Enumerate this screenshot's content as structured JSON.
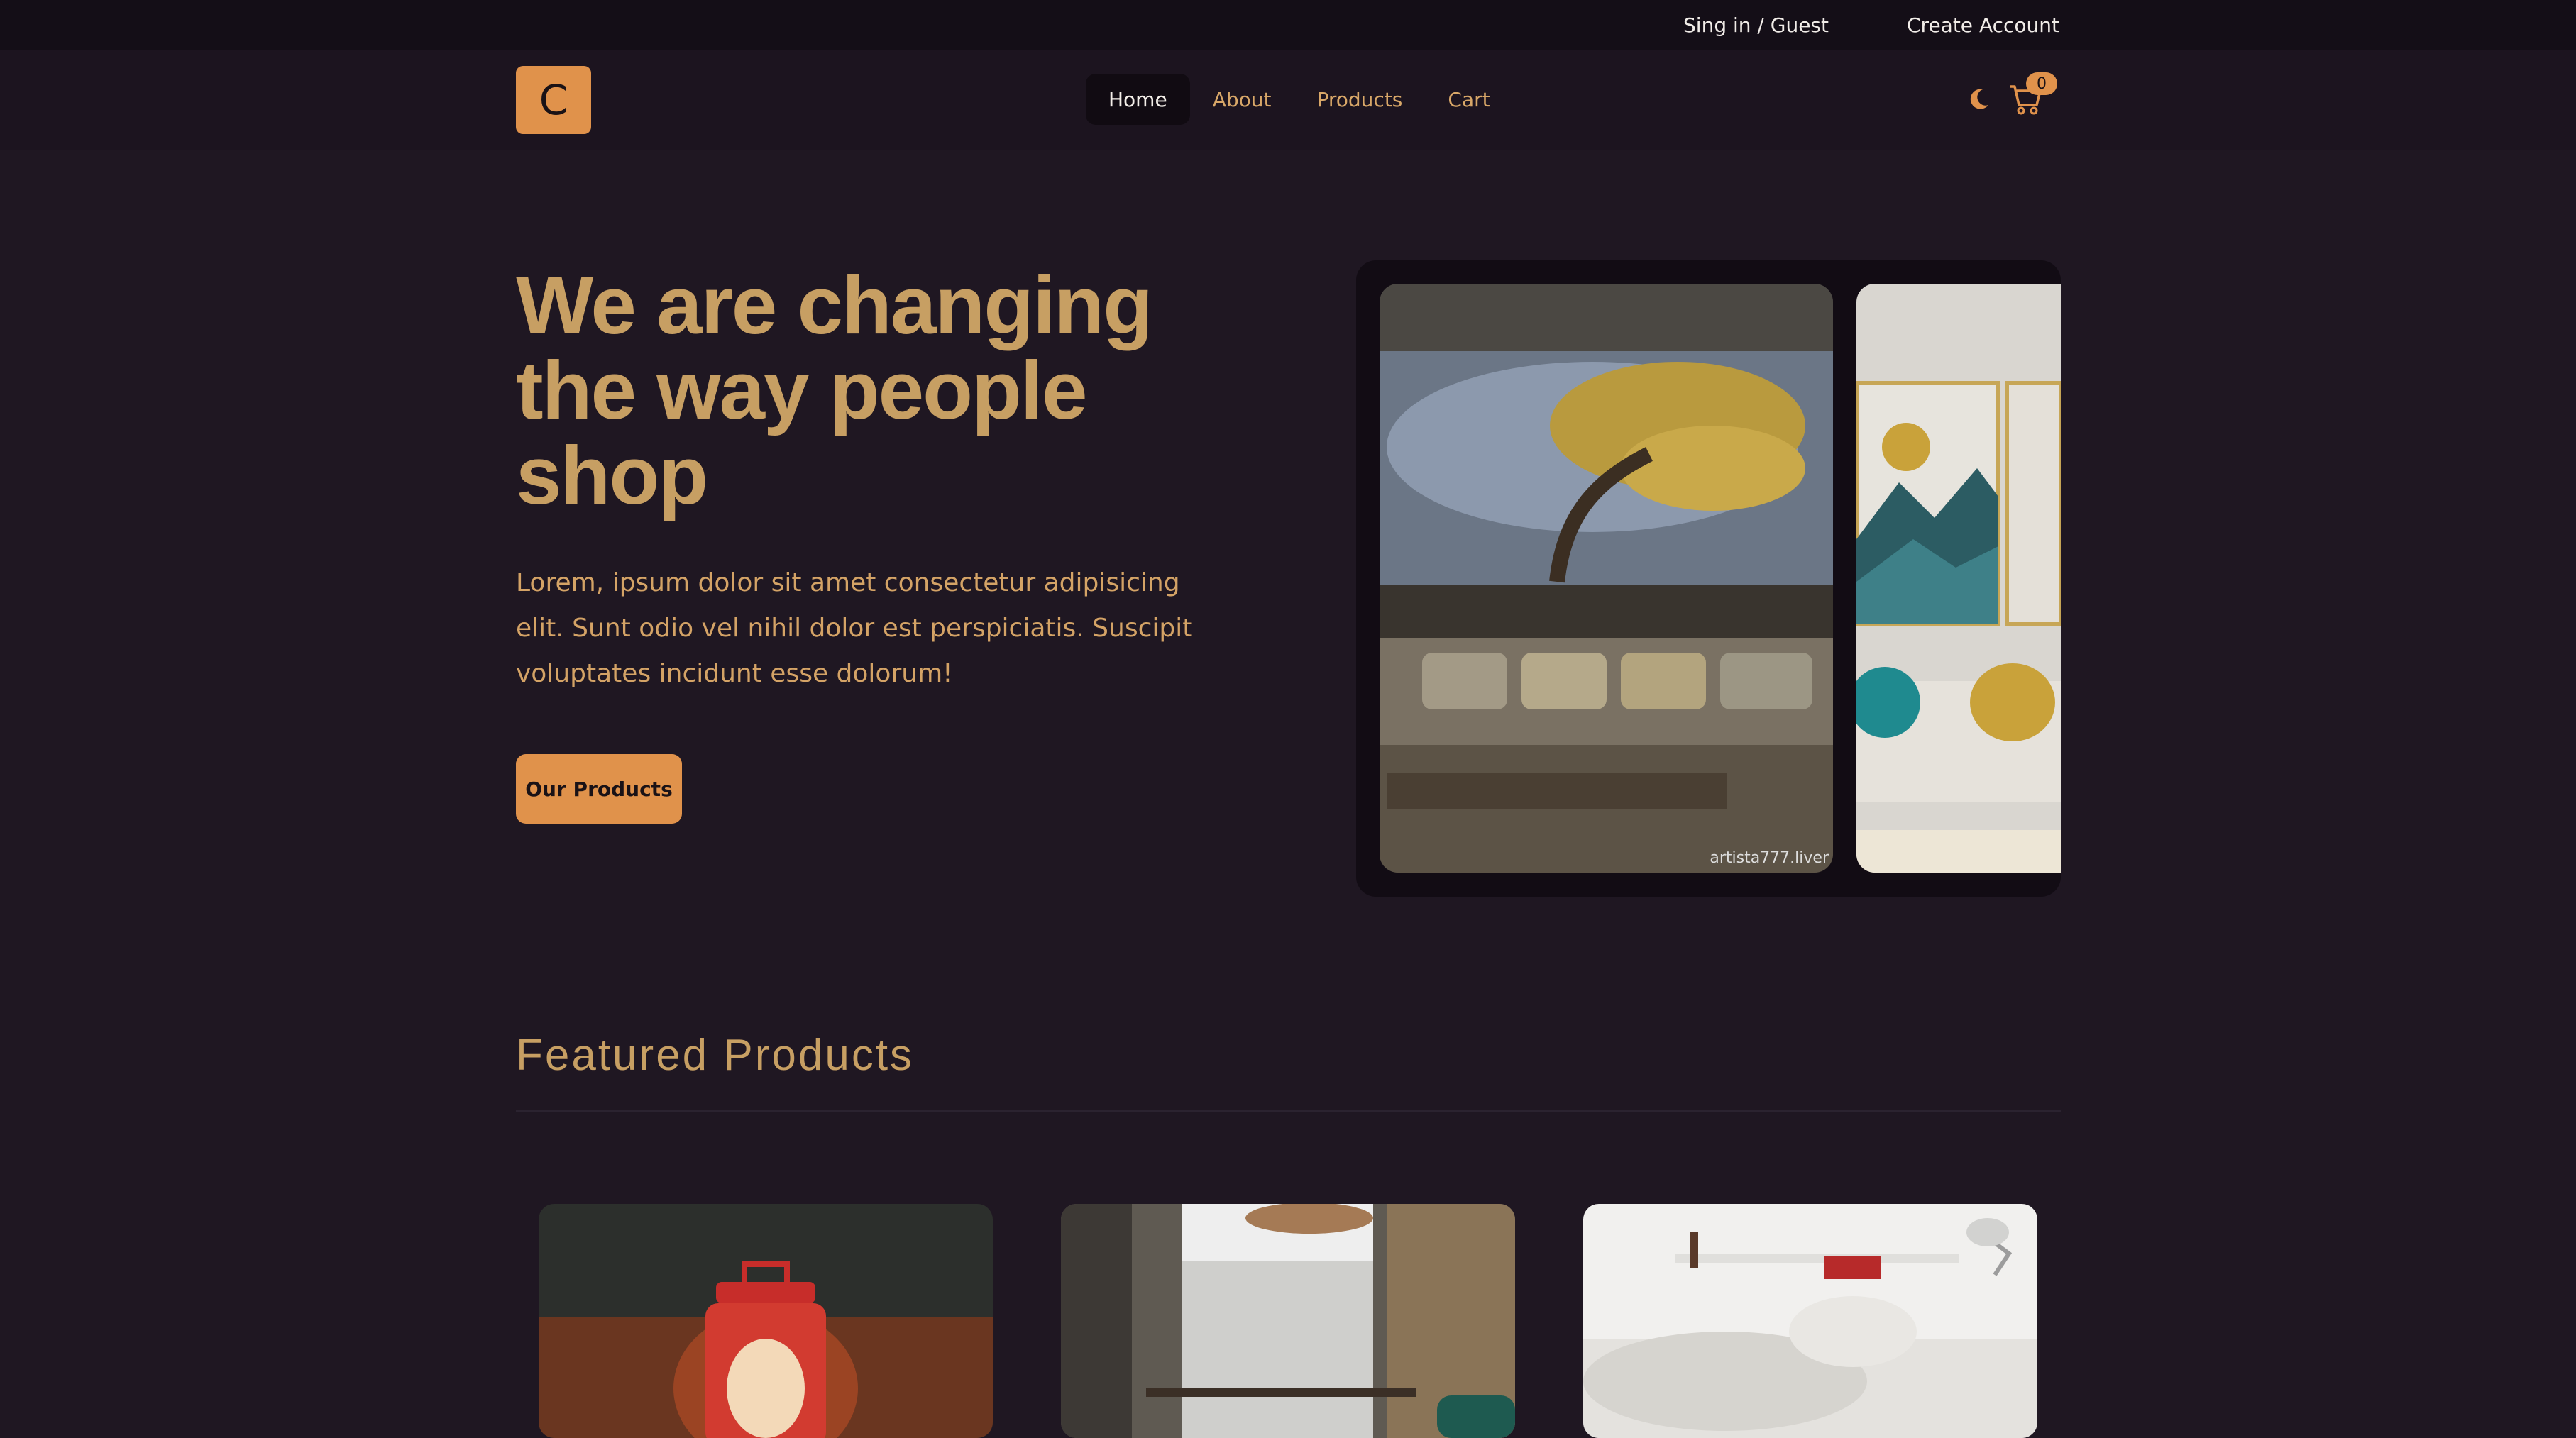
{
  "topbar": {
    "signin": "Sing in / Guest",
    "create_account": "Create Account"
  },
  "brand": {
    "logo_letter": "C"
  },
  "nav": {
    "items": [
      "Home",
      "About",
      "Products",
      "Cart"
    ],
    "active": "Home"
  },
  "cart": {
    "count": "0"
  },
  "hero": {
    "title": "We are changing the way people shop",
    "description": "Lorem, ipsum dolor sit amet consectetur adipisicing elit. Sunt odio vel nihil dolor est perspiciatis. Suscipit voluptates incidunt esse dolorum!",
    "cta": "Our Products"
  },
  "carousel": {
    "watermark": "artista777.liver"
  },
  "featured": {
    "title": "Featured Products"
  },
  "colors": {
    "accent": "#e0924b",
    "text_gold": "#c79f63",
    "background": "#1f1722"
  },
  "icons": [
    "moon-icon",
    "cart-icon"
  ]
}
